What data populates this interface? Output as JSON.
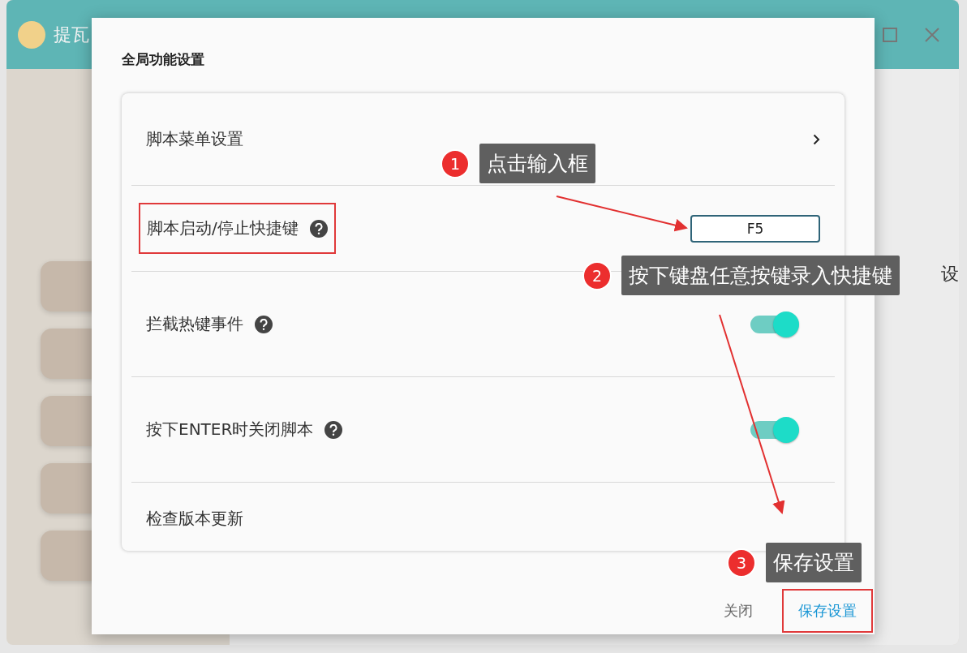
{
  "app": {
    "title": "提瓦",
    "side_text": "设"
  },
  "dialog": {
    "title": "全局功能设置",
    "rows": [
      {
        "kind": "link",
        "label": "脚本菜单设置"
      },
      {
        "kind": "hotkey",
        "label": "脚本启动/停止快捷键",
        "help": true,
        "value": "F5",
        "highlighted": true
      },
      {
        "kind": "toggle",
        "label": "拦截热键事件",
        "help": true,
        "on": true
      },
      {
        "kind": "toggle",
        "label": "按下ENTER时关闭脚本",
        "help": true,
        "on": true
      },
      {
        "kind": "plain",
        "label": "检查版本更新"
      }
    ],
    "buttons": [
      {
        "label": "关闭",
        "primary": false,
        "highlighted": false
      },
      {
        "label": "保存设置",
        "primary": true,
        "highlighted": true
      }
    ]
  },
  "annotations": [
    {
      "number": "1",
      "text": "点击输入框"
    },
    {
      "number": "2",
      "text": "按下键盘任意按键录入快捷键"
    },
    {
      "number": "3",
      "text": "保存设置"
    }
  ]
}
